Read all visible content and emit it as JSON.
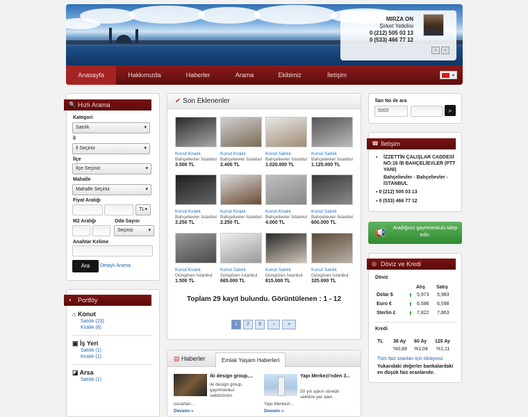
{
  "agent": {
    "name": "MIRZA ON",
    "title": "Şirket Yetkilisi",
    "phone1": "0 (212) 505 03 13",
    "phone2": "0 (533) 466 77 12",
    "prev": "‹",
    "next": "›"
  },
  "nav": {
    "items": [
      "Anasayfa",
      "Hakkımızda",
      "Haberler",
      "Arama",
      "Ekibimiz",
      "İletişim"
    ]
  },
  "search": {
    "title": "Hızlı Arama",
    "kategori_label": "Kategori",
    "kategori_value": "Satılık",
    "il_label": "İl",
    "il_value": "İl Seçiniz",
    "ilce_label": "İlçe",
    "ilce_value": "İlçe Seçiniz",
    "mahalle_label": "Mahalle",
    "mahalle_value": "Mahalle Seçiniz",
    "fiyat_label": "Fiyat Aralığı",
    "currency": "TL",
    "m2_label": "M2 Aralığı",
    "oda_label": "Oda Sayısı",
    "oda_value": "Seçiniz",
    "keyword_label": "Anahtar Kelime",
    "button": "Ara",
    "detail_link": "Detaylı Arama"
  },
  "portfolio": {
    "title": "Portföy",
    "groups": [
      {
        "name": "Konut",
        "lines": [
          "Satılık (23)",
          "Kiralık (6)"
        ]
      },
      {
        "name": "İş Yeri",
        "lines": [
          "Satılık (1)",
          "Kiralık (1)"
        ]
      },
      {
        "name": "Arsa",
        "lines": [
          "Satılık (1)"
        ]
      }
    ]
  },
  "recent": {
    "title": "Son Eklenenler",
    "listings": [
      {
        "type": "Konut Kiralık",
        "loc": "Bahçelievler İstanbul",
        "price": "3.500 TL"
      },
      {
        "type": "Konut Kiralık",
        "loc": "Bahçelievler İstanbul",
        "price": "2.400 TL"
      },
      {
        "type": "Konut Satılık",
        "loc": "Bahçelievler İstanbul",
        "price": "1.020.000 TL"
      },
      {
        "type": "Konut Satılık",
        "loc": "Bahçelievler İstanbul",
        "price": "1.125.000 TL"
      },
      {
        "type": "Konut Kiralık",
        "loc": "Bahçelievler İstanbul",
        "price": "3.250 TL"
      },
      {
        "type": "Konut Kiralık",
        "loc": "Bahçelievler İstanbul",
        "price": "2.250 TL"
      },
      {
        "type": "Konut Kiralık",
        "loc": "Bahçelievler İstanbul",
        "price": "4.000 TL"
      },
      {
        "type": "Konut Satılık",
        "loc": "Bahçelievler İstanbul",
        "price": "600.000 TL"
      },
      {
        "type": "Konut Kiralık",
        "loc": "Güngören İstanbul",
        "price": "1.500 TL"
      },
      {
        "type": "Konut Satılık",
        "loc": "Güngören İstanbul",
        "price": "665.000 TL"
      },
      {
        "type": "Konut Satılık",
        "loc": "Güngören İstanbul",
        "price": "815.000 TL"
      },
      {
        "type": "Konut Satılık",
        "loc": "Güngören İstanbul",
        "price": "325.000 TL"
      }
    ],
    "summary": "Toplam 29 kayıt bulundu. Görüntülenen : 1 - 12",
    "pages": [
      "1",
      "2",
      "3",
      "›",
      "»"
    ]
  },
  "news": {
    "tab1": "Haberler",
    "tab2": "Emlak Yaşam Haberleri",
    "items": [
      {
        "title": "iki design group,...",
        "text1": "iki design group,",
        "text2": "gayrimenkul",
        "text3": "sektörünün",
        "text4": "oscarları...",
        "more": "Devamı »"
      },
      {
        "title": "Yapı Merkezi'nden 3...",
        "text1": "50 yılı aşkın süredir",
        "text2": "sektöre yer alan",
        "text3": "Yapı Merkezi...",
        "text4": "",
        "more": "Devamı »"
      }
    ]
  },
  "idsearch": {
    "label": "İlan No ile ara",
    "value": "5000"
  },
  "contact": {
    "title": "İletişim",
    "address": "İZZETTİN ÇALIŞLAR CADDESİ NO:16 /B BAHÇELİEVLER (PTT YANI)",
    "district": "Bahçelievler - Bahçelievler - İSTANBUL",
    "phone1": "0 (212) 505 03 13",
    "phone2": "0 (533) 466 77 12"
  },
  "request": {
    "text": "Aradığınız gayrimenkulü talep edin."
  },
  "finance": {
    "title": "Döviz ve Kredi",
    "doviz": "Döviz",
    "alis": "Alış",
    "satis": "Satış",
    "rates": [
      {
        "name": "Dolar $",
        "alis": "5,973",
        "satis": "5,983"
      },
      {
        "name": "Euro €",
        "alis": "6,586",
        "satis": "6,598"
      },
      {
        "name": "Sterlin £",
        "alis": "7,822",
        "satis": "7,863"
      }
    ],
    "kredi": "Kredi",
    "terms": [
      "36 Ay",
      "60 Ay",
      "120 Ay"
    ],
    "currency": "TL",
    "rates_pct": [
      "%0,88",
      "%1,04",
      "%1,11"
    ],
    "all_link": "Tüm faiz oranları için tıklayınız.",
    "note": "Yukarıdaki değerler bankalardaki en düşük faiz oranlarıdır."
  },
  "colors": {
    "accent": "#7a1212",
    "link": "#1f5fae",
    "up": "#27a02b"
  }
}
